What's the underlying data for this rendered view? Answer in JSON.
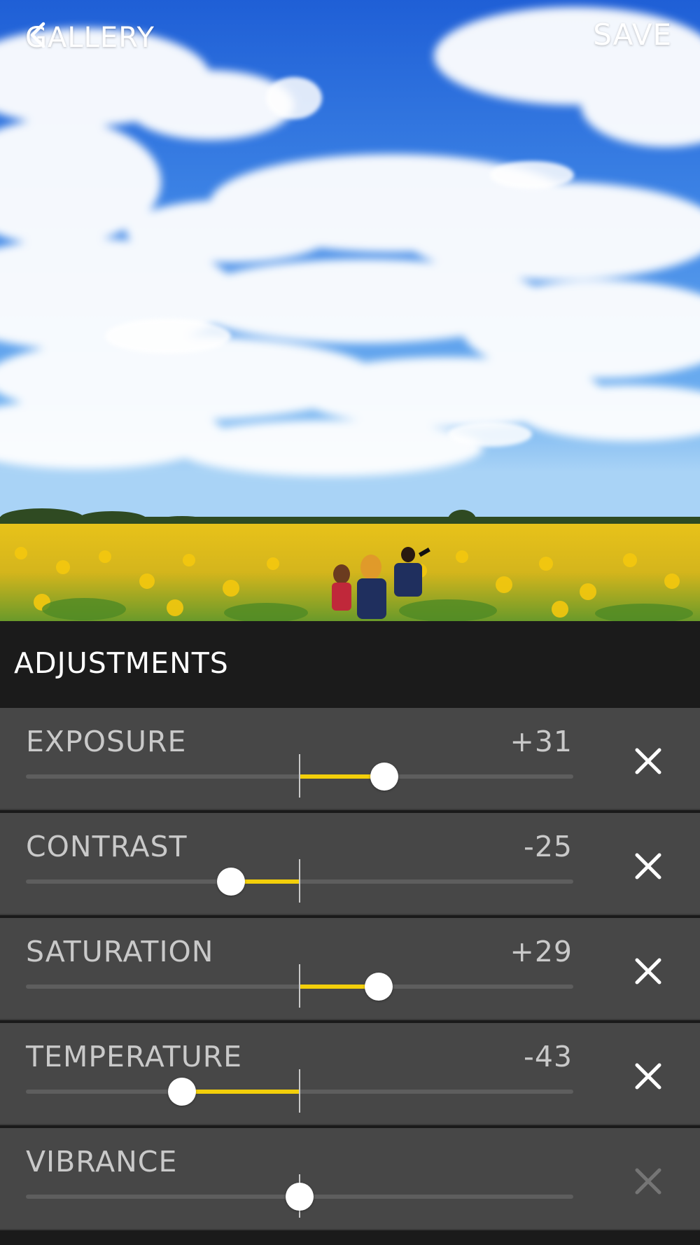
{
  "topbar": {
    "back_label": "GALLERY",
    "back_icon": "chevron-left-icon",
    "save_label": "SAVE"
  },
  "photo": {
    "subject": "sunflower field under blue sky with clouds"
  },
  "adjustments": {
    "title": "ADJUSTMENTS",
    "items": [
      {
        "label": "EXPOSURE",
        "value_text": "+31",
        "value": 31,
        "reset_enabled": true
      },
      {
        "label": "CONTRAST",
        "value_text": "-25",
        "value": -25,
        "reset_enabled": true
      },
      {
        "label": "SATURATION",
        "value_text": "+29",
        "value": 29,
        "reset_enabled": true
      },
      {
        "label": "TEMPERATURE",
        "value_text": "-43",
        "value": -43,
        "reset_enabled": true
      },
      {
        "label": "VIBRANCE",
        "value_text": "",
        "value": 0,
        "reset_enabled": false
      }
    ],
    "range": [
      -100,
      100
    ]
  },
  "colors": {
    "accent": "#f3cf0a",
    "row_bg": "#474747",
    "header_bg": "#1b1b1b"
  }
}
